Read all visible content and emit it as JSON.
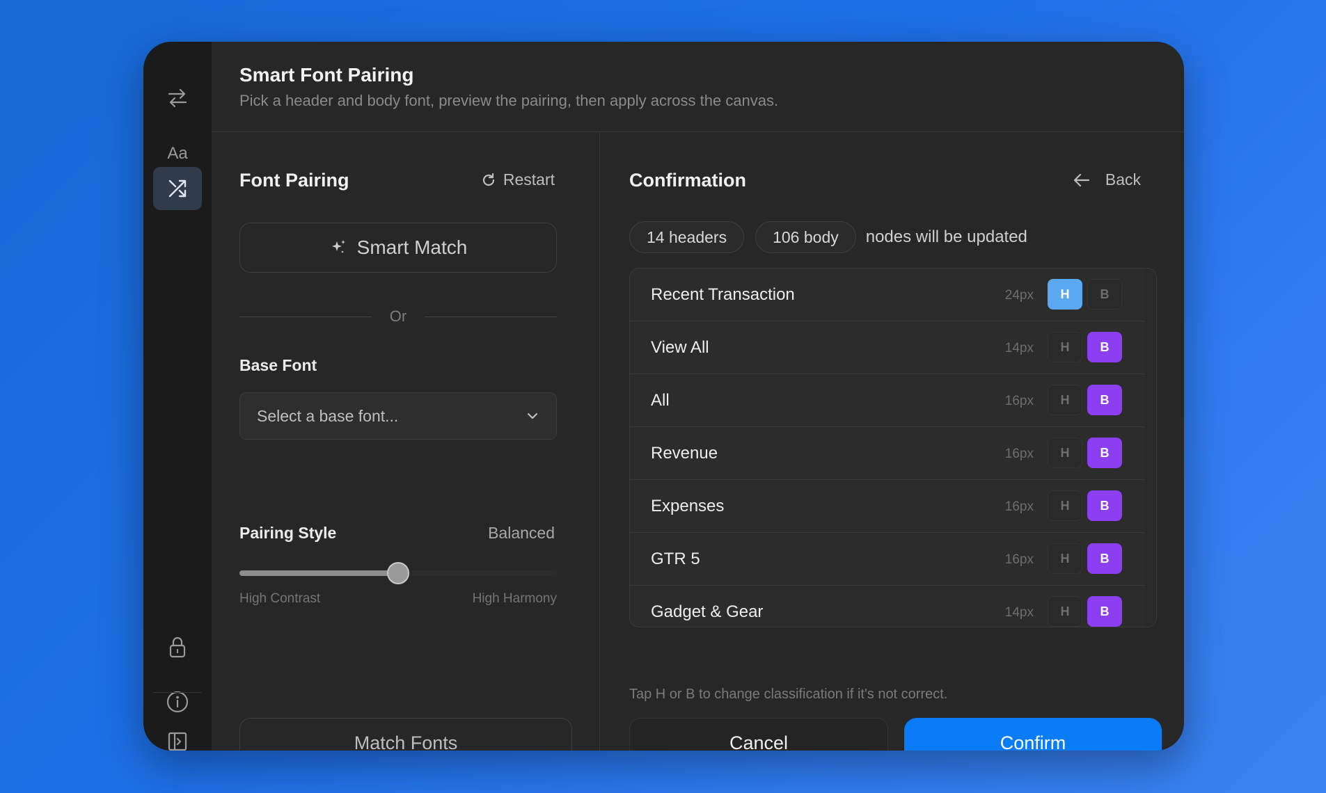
{
  "header": {
    "title": "Smart Font Pairing",
    "subtitle": "Pick a header and body font, preview the pairing, then apply across the canvas."
  },
  "rail": {
    "items": [
      {
        "icon": "swap-arrows-icon"
      },
      {
        "icon": "typography-icon",
        "label": "Aa"
      },
      {
        "icon": "shuffle-icon",
        "active": true
      },
      {
        "icon": "lock-icon"
      },
      {
        "icon": "info-icon"
      },
      {
        "icon": "sidebar-toggle-icon"
      }
    ]
  },
  "left": {
    "title": "Font Pairing",
    "restart_label": "Restart",
    "smart_match_label": "Smart Match",
    "or_label": "Or",
    "base_font_label": "Base Font",
    "base_font_placeholder": "Select a base font...",
    "pairing_style_label": "Pairing Style",
    "pairing_style_value": "Balanced",
    "slider_value_percent": 50,
    "slider_min_label": "High Contrast",
    "slider_max_label": "High Harmony",
    "match_fonts_label": "Match Fonts"
  },
  "right": {
    "title": "Confirmation",
    "back_label": "Back",
    "chip_headers": "14 headers",
    "chip_body": "106 body",
    "chip_note": "nodes will be updated",
    "h_label": "H",
    "b_label": "B",
    "rows": [
      {
        "name": "Recent Transaction",
        "size": "24px",
        "class": "H"
      },
      {
        "name": "View All",
        "size": "14px",
        "class": "B"
      },
      {
        "name": "All",
        "size": "16px",
        "class": "B"
      },
      {
        "name": "Revenue",
        "size": "16px",
        "class": "B"
      },
      {
        "name": "Expenses",
        "size": "16px",
        "class": "B"
      },
      {
        "name": "GTR 5",
        "size": "16px",
        "class": "B"
      },
      {
        "name": "Gadget & Gear",
        "size": "14px",
        "class": "B"
      }
    ],
    "hint": "Tap H or B to change classification if it's not correct.",
    "cancel_label": "Cancel",
    "confirm_label": "Confirm"
  },
  "colors": {
    "accent": "#0a7cf5",
    "header_tag": "#5aa8f0",
    "body_tag": "#8b3ff0"
  }
}
